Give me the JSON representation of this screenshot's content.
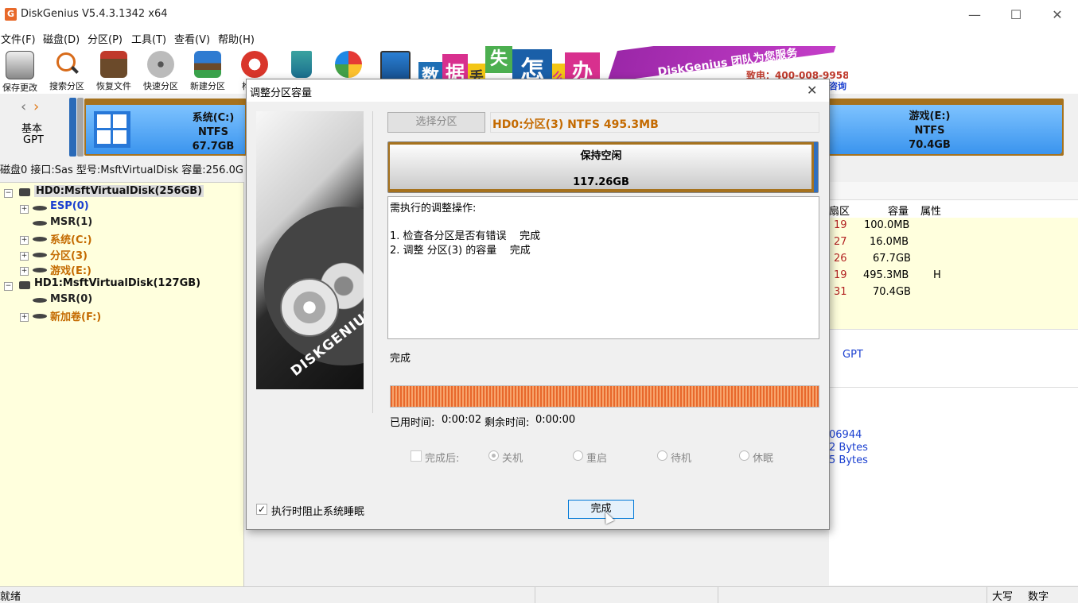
{
  "window": {
    "title": "DiskGenius V5.4.3.1342 x64",
    "icon_text": "G",
    "min": "—",
    "max": "☐",
    "close": "✕"
  },
  "menu": [
    "文件(F)",
    "磁盘(D)",
    "分区(P)",
    "工具(T)",
    "查看(V)",
    "帮助(H)"
  ],
  "toolbar": {
    "items": [
      {
        "label": "保存更改",
        "icon": "save-icon"
      },
      {
        "label": "搜索分区",
        "icon": "search-icon"
      },
      {
        "label": "恢复文件",
        "icon": "recover-icon"
      },
      {
        "label": "快速分区",
        "icon": "quick-partition-icon"
      },
      {
        "label": "新建分区",
        "icon": "new-partition-icon"
      }
    ],
    "partial_label": "构"
  },
  "banner": {
    "chars": [
      "数",
      "据",
      "丢",
      "失",
      "怎",
      "么",
      "办"
    ],
    "slogan": "DiskGenius 团队为您服务",
    "phone": "致电：400-008-9958",
    "consult": "咨询"
  },
  "diskbar": {
    "nav_left": "‹",
    "nav_right": "›",
    "disk_type_line1": "基本",
    "disk_type_line2": "GPT",
    "partition_c": {
      "name": "系统(C:)",
      "fs": "NTFS",
      "size": "67.7GB"
    },
    "partition_e": {
      "name": "游戏(E:)",
      "fs": "NTFS",
      "size": "70.4GB"
    }
  },
  "info_line": "磁盘0 接口:Sas  型号:MsftVirtualDisk  容量:256.0G",
  "tree": {
    "hd0": "HD0:MsftVirtualDisk(256GB)",
    "hd0_parts": [
      {
        "label": "ESP(0)",
        "color": "#1a3fd0",
        "expand": true
      },
      {
        "label": "MSR(1)",
        "color": "#222222",
        "expand": false
      },
      {
        "label": "系统(C:)",
        "color": "#c46a00",
        "expand": true
      },
      {
        "label": "分区(3)",
        "color": "#c46a00",
        "expand": true
      },
      {
        "label": "游戏(E:)",
        "color": "#c46a00",
        "expand": true
      }
    ],
    "hd1": "HD1:MsftVirtualDisk(127GB)",
    "hd1_parts": [
      {
        "label": "MSR(0)",
        "color": "#222222",
        "expand": false
      },
      {
        "label": "新加卷(F:)",
        "color": "#c46a00",
        "expand": true
      }
    ],
    "expand_sym": "⊟",
    "collapse_sym": "⊞"
  },
  "table": {
    "headers": {
      "sector": "扇区",
      "capacity": "容量",
      "attr": "属性"
    },
    "rows": [
      {
        "sector": "19",
        "capacity": "100.0MB",
        "attr": ""
      },
      {
        "sector": "27",
        "capacity": "16.0MB",
        "attr": ""
      },
      {
        "sector": "26",
        "capacity": "67.7GB",
        "attr": ""
      },
      {
        "sector": "19",
        "capacity": "495.3MB",
        "attr": "H"
      },
      {
        "sector": "31",
        "capacity": "70.4GB",
        "attr": ""
      }
    ],
    "gpt": "GPT",
    "num1": "06944",
    "bytes1": "2 Bytes",
    "bytes2": "5 Bytes"
  },
  "statusbar": {
    "ready": "就绪",
    "caps": "大写",
    "num": "数字"
  },
  "dialog": {
    "title": "调整分区容量",
    "close": "✕",
    "select_btn": "选择分区",
    "partition_value": "HD0:分区(3) NTFS 495.3MB",
    "keep_free_label": "保持空闲",
    "keep_free_size": "117.26GB",
    "ops_title": "需执行的调整操作:",
    "ops": [
      "1. 检查各分区是否有错误    完成",
      "2. 调整 分区(3) 的容量    完成"
    ],
    "status": "完成",
    "progress_percent": 100,
    "elapsed_label": "已用时间:",
    "elapsed": "0:00:02",
    "remaining_label": "剩余时间:",
    "remaining": "0:00:00",
    "after_label": "完成后:",
    "after_options": [
      "关机",
      "重启",
      "待机",
      "休眠"
    ],
    "after_selected": "关机",
    "prevent_sleep": "执行时阻止系统睡眠",
    "prevent_sleep_checked": true,
    "done_btn": "完成",
    "logo_text": "DISKGENIUS"
  }
}
